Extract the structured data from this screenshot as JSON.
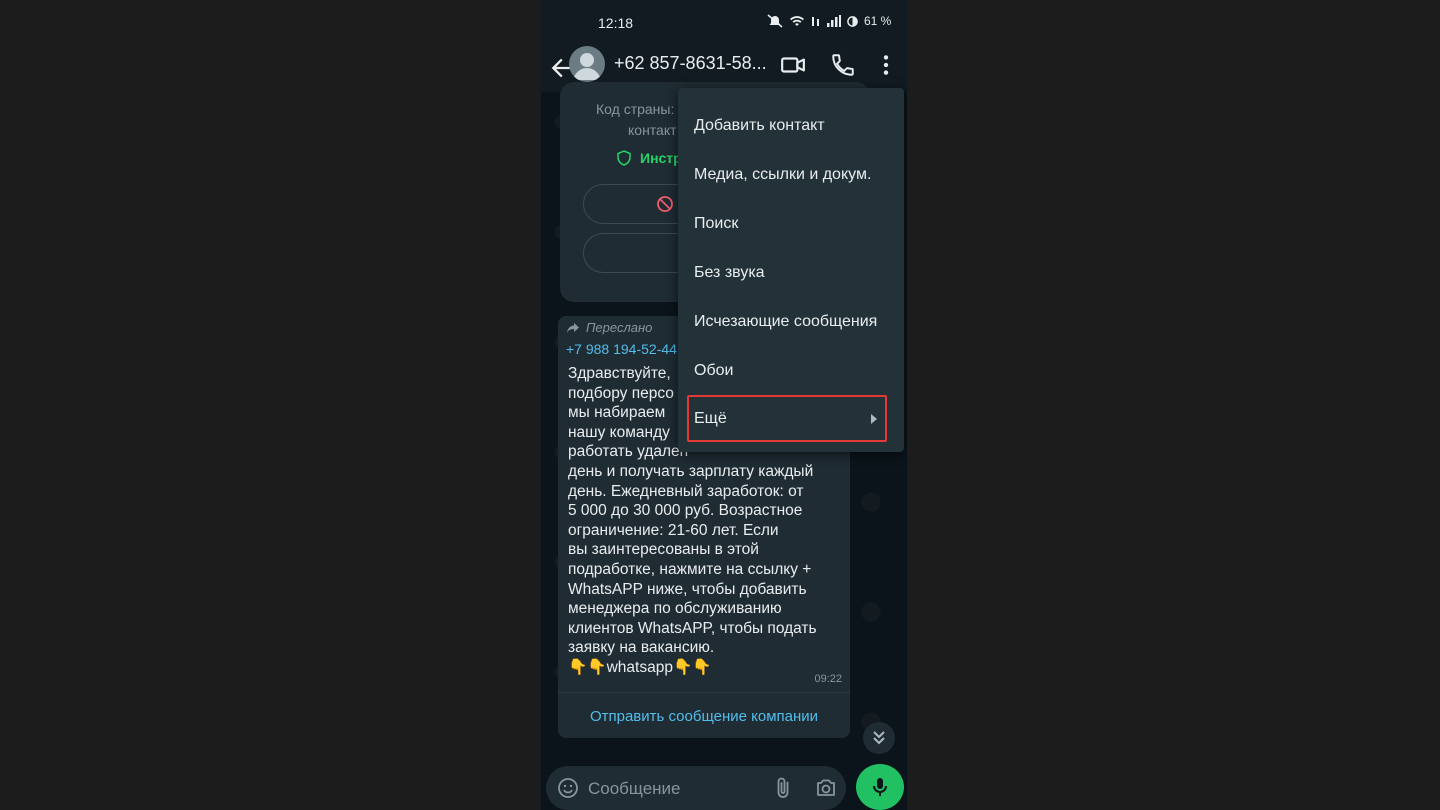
{
  "status_bar": {
    "time": "12:18",
    "battery": "61 %"
  },
  "header": {
    "contact_name": "+62 857-8631-58..."
  },
  "info_card": {
    "line1": "Код страны:",
    "line2": "контакт",
    "link": "Инстр"
  },
  "message": {
    "forwarded_label": "Переслано",
    "sender": "+7 988 194-52-44",
    "body_lines": [
      "Здравствуйте,",
      "подбору персо",
      "мы набираем",
      "нашу команду",
      "работать удален",
      "день и получать зарплату каждый",
      "день. Ежедневный заработок: от",
      "5 000 до 30 000 руб. Возрастное",
      "ограничение: 21-60 лет. Если",
      "вы заинтересованы в этой",
      "подработке, нажмите на ссылку +",
      "WhatsAPP  ниже, чтобы добавить",
      "менеджера по обслуживанию",
      "клиентов WhatsAPP, чтобы подать",
      "заявку на вакансию.",
      "👇👇whatsapp👇👇"
    ],
    "time": "09:22",
    "action": "Отправить сообщение компании"
  },
  "input": {
    "placeholder": "Сообщение"
  },
  "menu": {
    "items": [
      {
        "label": "Добавить контакт"
      },
      {
        "label": "Медиа, ссылки и докум."
      },
      {
        "label": "Поиск"
      },
      {
        "label": "Без звука"
      },
      {
        "label": "Исчезающие сообщения"
      },
      {
        "label": "Обои"
      },
      {
        "label": "Ещё"
      }
    ]
  },
  "colors": {
    "accent": "#21c063",
    "link": "#53bdeb",
    "highlight": "#e53935"
  }
}
